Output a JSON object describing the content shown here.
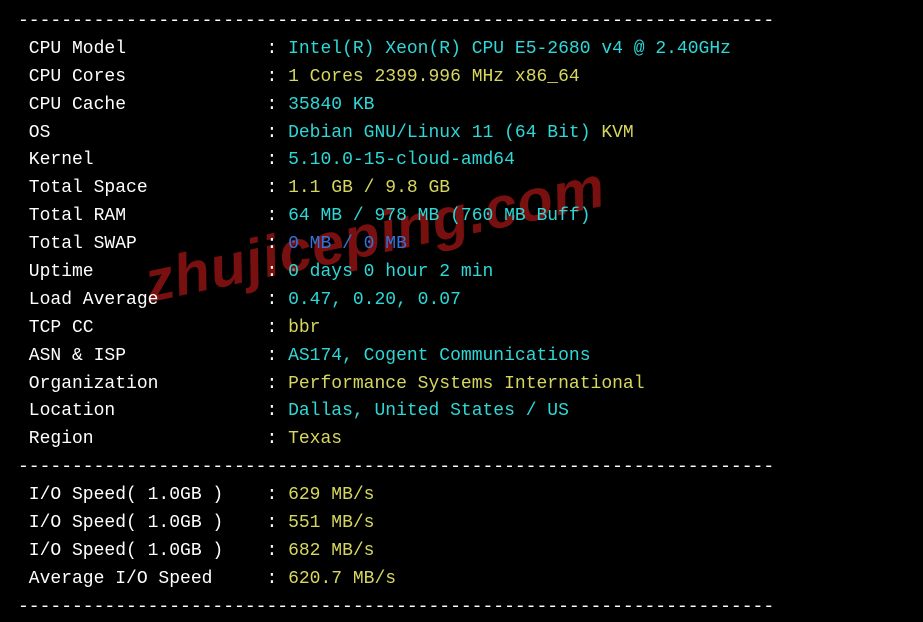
{
  "divider": "----------------------------------------------------------------------",
  "watermark": "zhujiceping.com",
  "sysinfo": [
    {
      "label": "CPU Model",
      "parts": [
        {
          "text": "Intel(R) Xeon(R) CPU E5-2680 v4 @ 2.40GHz",
          "cls": "cyan"
        }
      ]
    },
    {
      "label": "CPU Cores",
      "parts": [
        {
          "text": "1 Cores 2399.996 MHz x86_64",
          "cls": "yellow"
        }
      ]
    },
    {
      "label": "CPU Cache",
      "parts": [
        {
          "text": "35840 KB",
          "cls": "cyan"
        }
      ]
    },
    {
      "label": "OS",
      "parts": [
        {
          "text": "Debian GNU/Linux 11 (64 Bit) ",
          "cls": "cyan"
        },
        {
          "text": "KVM",
          "cls": "yellow"
        }
      ]
    },
    {
      "label": "Kernel",
      "parts": [
        {
          "text": "5.10.0-15-cloud-amd64",
          "cls": "cyan"
        }
      ]
    },
    {
      "label": "Total Space",
      "parts": [
        {
          "text": "1.1 GB / 9.8 GB",
          "cls": "yellow"
        }
      ]
    },
    {
      "label": "Total RAM",
      "parts": [
        {
          "text": "64 MB / 978 MB (760 MB Buff)",
          "cls": "cyan"
        }
      ]
    },
    {
      "label": "Total SWAP",
      "parts": [
        {
          "text": "0 MB / 0 MB",
          "cls": "blue"
        }
      ]
    },
    {
      "label": "Uptime",
      "parts": [
        {
          "text": "0 days 0 hour 2 min",
          "cls": "cyan"
        }
      ]
    },
    {
      "label": "Load Average",
      "parts": [
        {
          "text": "0.47, 0.20, 0.07",
          "cls": "cyan"
        }
      ]
    },
    {
      "label": "TCP CC",
      "parts": [
        {
          "text": "bbr",
          "cls": "yellow"
        }
      ]
    },
    {
      "label": "ASN & ISP",
      "parts": [
        {
          "text": "AS174, Cogent Communications",
          "cls": "cyan"
        }
      ]
    },
    {
      "label": "Organization",
      "parts": [
        {
          "text": "Performance Systems International",
          "cls": "yellow"
        }
      ]
    },
    {
      "label": "Location",
      "parts": [
        {
          "text": "Dallas, United States / US",
          "cls": "cyan"
        }
      ]
    },
    {
      "label": "Region",
      "parts": [
        {
          "text": "Texas",
          "cls": "yellow"
        }
      ]
    }
  ],
  "iospeed": [
    {
      "label": "I/O Speed( 1.0GB )",
      "parts": [
        {
          "text": "629 MB/s",
          "cls": "yellow"
        }
      ]
    },
    {
      "label": "I/O Speed( 1.0GB )",
      "parts": [
        {
          "text": "551 MB/s",
          "cls": "yellow"
        }
      ]
    },
    {
      "label": "I/O Speed( 1.0GB )",
      "parts": [
        {
          "text": "682 MB/s",
          "cls": "yellow"
        }
      ]
    },
    {
      "label": "Average I/O Speed",
      "parts": [
        {
          "text": "620.7 MB/s",
          "cls": "yellow"
        }
      ]
    }
  ]
}
